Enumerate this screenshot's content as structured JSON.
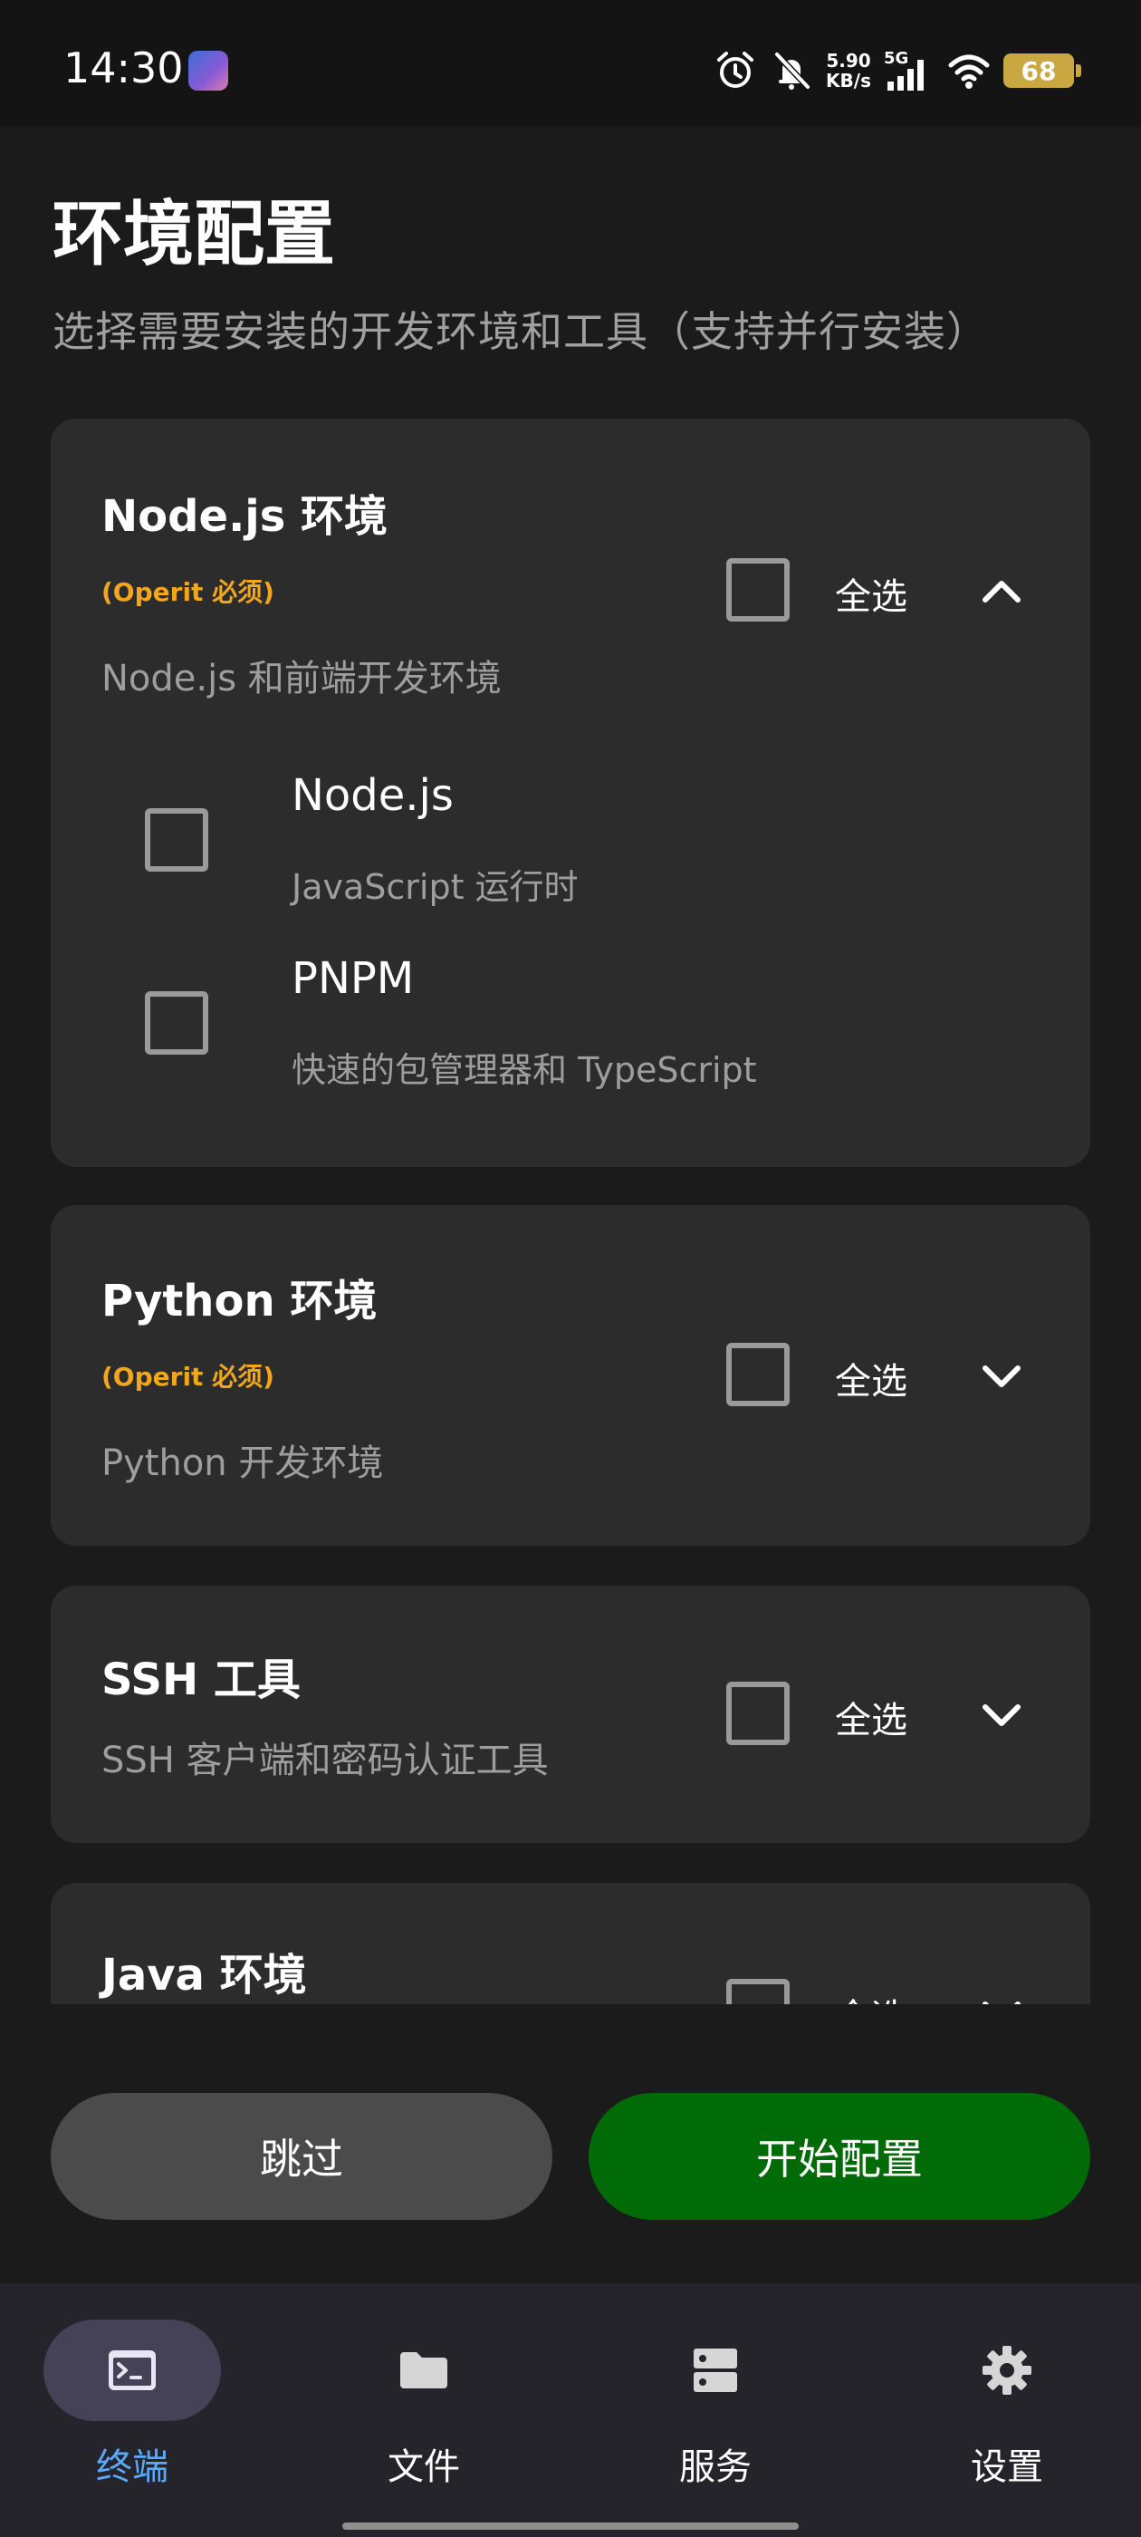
{
  "status_bar": {
    "time": "14:30",
    "net_speed_value": "5.90",
    "net_speed_unit": "KB/s",
    "signal_label": "5G",
    "battery_level": "68",
    "icons": [
      "app-avatar-icon",
      "alarm-icon",
      "mute-icon",
      "signal-icon",
      "wifi-icon",
      "battery-icon"
    ]
  },
  "header": {
    "title": "环境配置",
    "subtitle": "选择需要安装的开发环境和工具（支持并行安装）"
  },
  "cards": [
    {
      "title": "Node.js 环境",
      "badge": "(Operit 必须)",
      "description": "Node.js 和前端开发环境",
      "select_all_label": "全选",
      "expanded": true,
      "items": [
        {
          "title": "Node.js",
          "description": "JavaScript 运行时"
        },
        {
          "title": "PNPM",
          "description": "快速的包管理器和 TypeScript"
        }
      ]
    },
    {
      "title": "Python 环境",
      "badge": "(Operit 必须)",
      "description": "Python 开发环境",
      "select_all_label": "全选",
      "expanded": false
    },
    {
      "title": "SSH 工具",
      "description": "SSH 客户端和密码认证工具",
      "select_all_label": "全选",
      "expanded": false
    },
    {
      "title": "Java 环境",
      "select_all_label": "全选",
      "expanded": false
    }
  ],
  "actions": {
    "skip_label": "跳过",
    "start_label": "开始配置"
  },
  "bottom_nav": {
    "items": [
      {
        "label": "终端",
        "icon": "terminal-icon",
        "active": true
      },
      {
        "label": "文件",
        "icon": "folder-icon",
        "active": false
      },
      {
        "label": "服务",
        "icon": "server-icon",
        "active": false
      },
      {
        "label": "设置",
        "icon": "gear-icon",
        "active": false
      }
    ]
  },
  "colors": {
    "background": "#1b1b1b",
    "card": "#2c2c2c",
    "badge": "#f2a61e",
    "primary_button": "#006b07",
    "secondary_button": "#4b4b4b",
    "nav_active": "#5aa9ff",
    "nav_active_pill": "#454156"
  }
}
